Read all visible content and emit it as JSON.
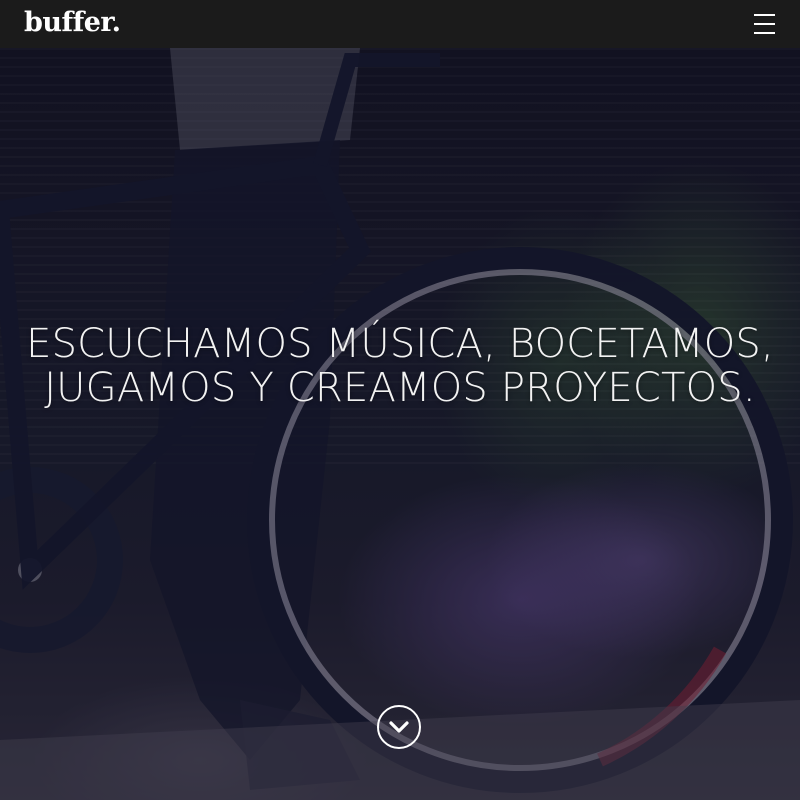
{
  "navbar": {
    "logo_text": "buffer.",
    "menu_icon": "hamburger-menu-icon"
  },
  "hero": {
    "headline_line1": "ESCUCHAMOS MÚSICA, BOCETAMOS,",
    "headline_line2": "JUGAMOS Y CREAMOS PROYECTOS.",
    "scroll_icon": "chevron-down-circle-icon"
  },
  "colors": {
    "navbar_bg": "#1b1b1b",
    "text": "#ffffff"
  }
}
